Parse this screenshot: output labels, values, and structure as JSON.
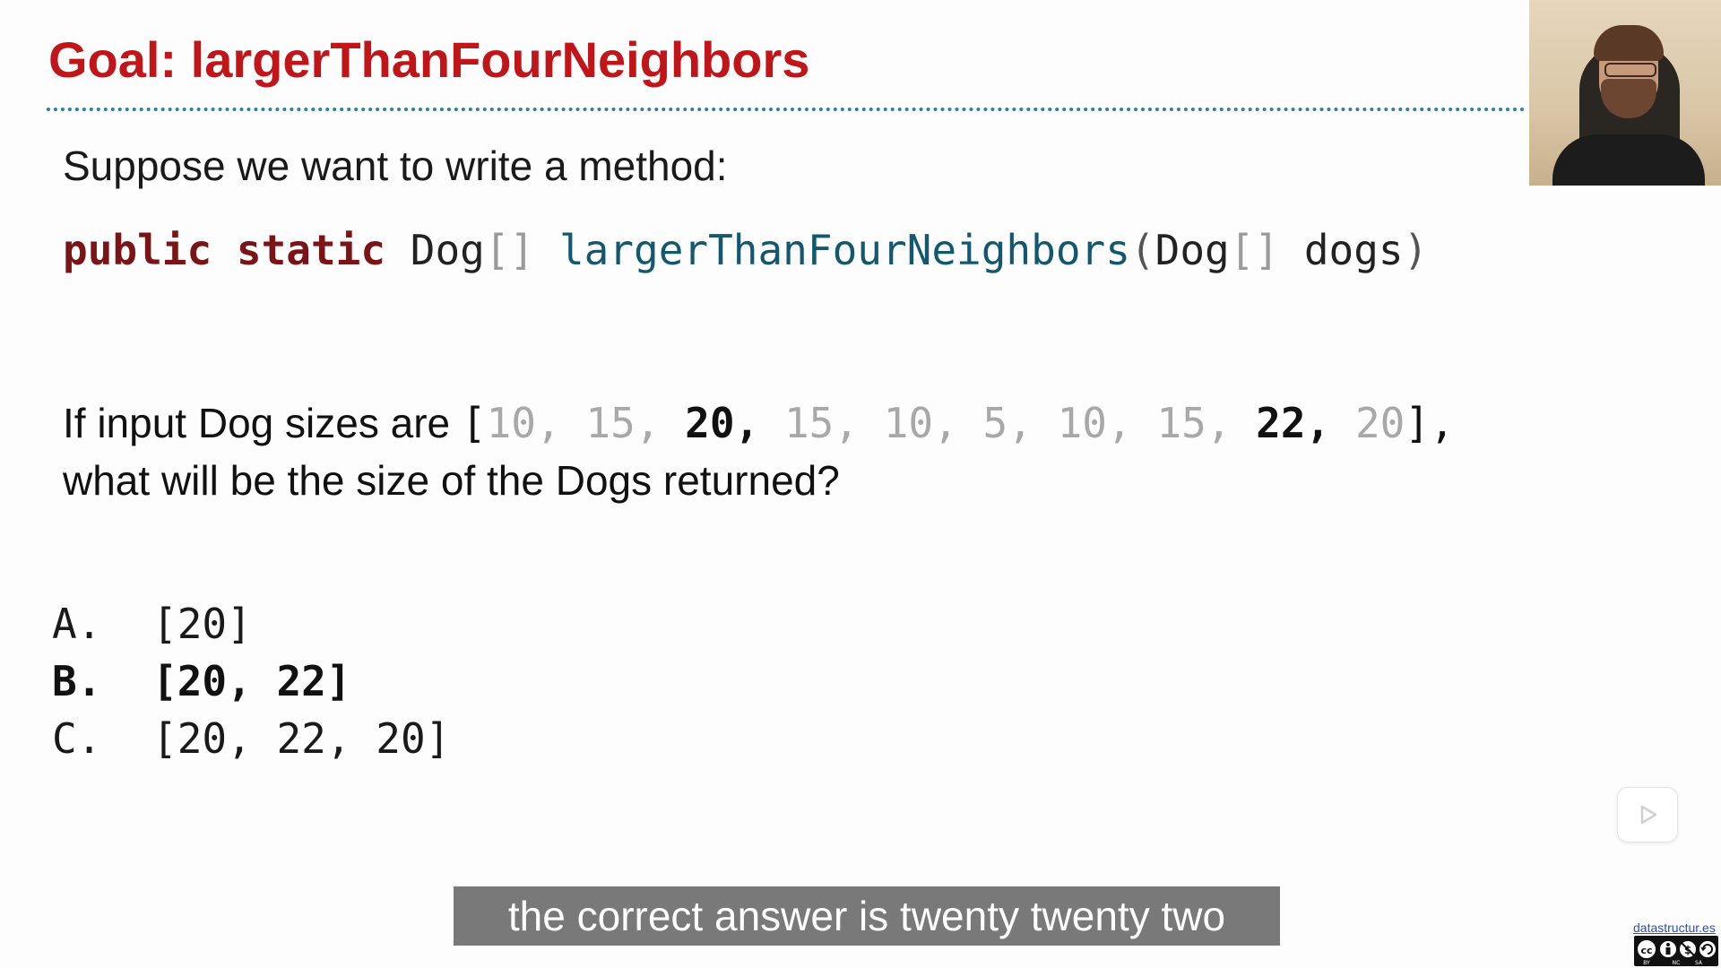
{
  "slide": {
    "title": "Goal: largerThanFourNeighbors",
    "intro": "Suppose we want to write a method:",
    "signature": {
      "kw_public": "public",
      "kw_static": "static",
      "return_type": "Dog",
      "return_brackets": "[]",
      "method_name": "largerThanFourNeighbors",
      "open_paren": "(",
      "param_type": "Dog",
      "param_brackets": "[]",
      "param_name": "dogs",
      "close_paren": ")"
    },
    "question": {
      "prefix": "If input Dog sizes are ",
      "open_bracket": "[",
      "sizes": [
        "10",
        "15",
        "20",
        "15",
        "10",
        "5",
        "10",
        "15",
        "22",
        "20"
      ],
      "highlighted_sizes": [
        "20",
        "22"
      ],
      "close_bracket": "],",
      "line2": "what will be the size of the Dogs returned?"
    },
    "options": [
      {
        "letter": "A.",
        "answer": "[20]"
      },
      {
        "letter": "B.",
        "answer": "[20, 22]"
      },
      {
        "letter": "C.",
        "answer": "[20, 22, 20]"
      }
    ]
  },
  "video": {
    "subtitle": "the correct answer is twenty twenty two",
    "play_icon": "play-icon",
    "webcam_icon": "presenter-webcam"
  },
  "footer": {
    "link_text": "datastructur.es",
    "license_icon": "cc-by-nc-sa-icon"
  },
  "colors": {
    "title": "#c0161a",
    "keyword": "#7a1416",
    "method": "#13586e",
    "divider": "#2f7fa3",
    "subtitle_bg": "#6e6e6e"
  }
}
